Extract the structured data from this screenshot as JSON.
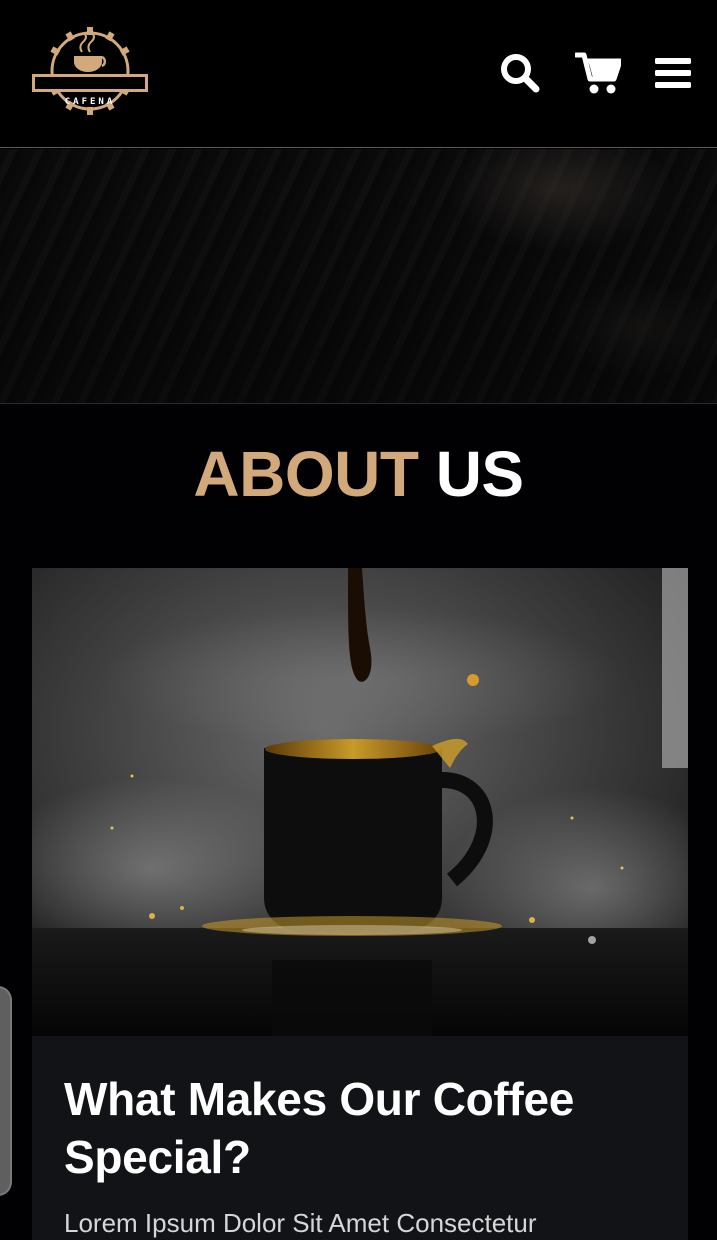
{
  "header": {
    "logo_text": "CAFENA",
    "icons": {
      "search": "search-icon",
      "cart": "cart-icon",
      "menu": "hamburger-menu-icon"
    }
  },
  "about": {
    "title_accent": "ABOUT",
    "title_plain": "US"
  },
  "card": {
    "heading": "What Makes Our Coffee Special?",
    "text": "Lorem Ipsum Dolor Sit Amet Consectetur"
  },
  "colors": {
    "accent": "#d1a97b",
    "background": "#010103",
    "card_background": "#121316",
    "text_primary": "#ffffff"
  }
}
